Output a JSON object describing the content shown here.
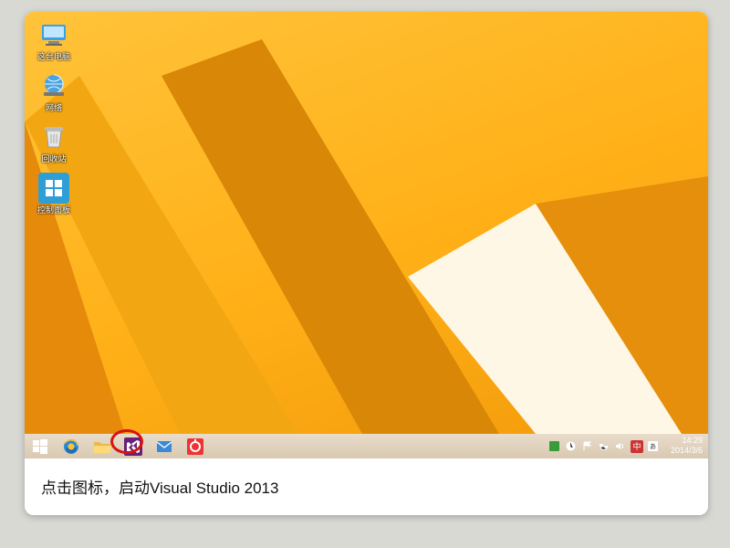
{
  "desktop": {
    "icons": [
      {
        "name": "computer",
        "label": "这台电脑"
      },
      {
        "name": "network",
        "label": "网络"
      },
      {
        "name": "recycle-bin",
        "label": "回收站"
      },
      {
        "name": "control-panel",
        "label": "控制面板"
      }
    ]
  },
  "taskbar": {
    "buttons": [
      {
        "name": "start",
        "tip": "Start"
      },
      {
        "name": "ie",
        "tip": "Internet Explorer"
      },
      {
        "name": "file-explorer",
        "tip": "File Explorer"
      },
      {
        "name": "visual-studio",
        "tip": "Visual Studio 2013"
      },
      {
        "name": "mail",
        "tip": "Mail"
      },
      {
        "name": "snagit",
        "tip": "Snagit"
      }
    ],
    "tray": [
      {
        "name": "action-center"
      },
      {
        "name": "updates"
      },
      {
        "name": "flag"
      },
      {
        "name": "network-tray"
      },
      {
        "name": "volume"
      },
      {
        "name": "ime"
      },
      {
        "name": "lang"
      }
    ],
    "clock": {
      "time": "14:29",
      "date": "2014/3/6"
    }
  },
  "highlight": {
    "target": "visual-studio"
  },
  "caption": "点击图标，启动Visual Studio 2013"
}
